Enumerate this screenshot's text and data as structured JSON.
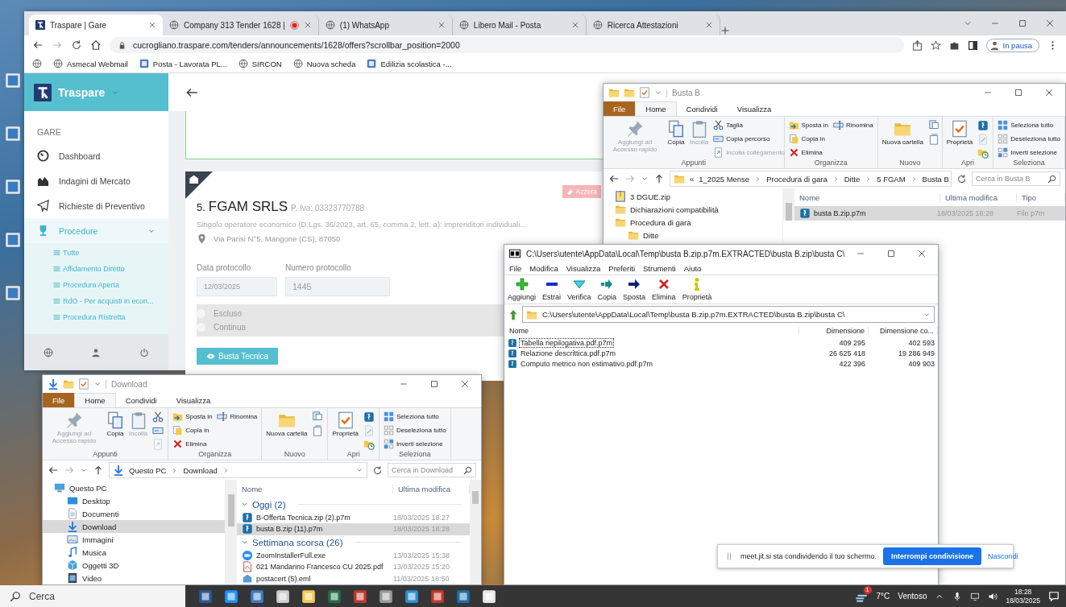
{
  "browser": {
    "tabs": [
      {
        "title": "Traspare | Gare",
        "selected": true,
        "recording": false
      },
      {
        "title": "Company 313 Tender 1628 |",
        "selected": false,
        "recording": true
      },
      {
        "title": "(1) WhatsApp",
        "selected": false,
        "recording": false
      },
      {
        "title": "Libero Mail - Posta",
        "selected": false,
        "recording": false
      },
      {
        "title": "Ricerca Attestazioni",
        "selected": false,
        "recording": false
      }
    ],
    "address": "cucrogliano.traspare.com/tenders/announcements/1628/offers?scrollbar_position=2000",
    "profile_status": "In pausa",
    "bookmarks": [
      "Asmecal Webmail",
      "Posta - Lavorata PL...",
      "SIRCON",
      "Nuova scheda",
      "Edilizia scolastica -..."
    ]
  },
  "app": {
    "brand": "Traspare",
    "section": "GARE",
    "nav": [
      {
        "label": "Dashboard",
        "selected": false,
        "expanded": false
      },
      {
        "label": "Indagini di Mercato",
        "selected": false,
        "expanded": false
      },
      {
        "label": "Richieste di Preventivo",
        "selected": false,
        "expanded": false
      },
      {
        "label": "Procedure",
        "selected": true,
        "expanded": true,
        "children": [
          "Tutte",
          "Affidamento Diretto",
          "Procedura Aperta",
          "RdO - Per acquisti in econ...",
          "Procedura Ristretta"
        ]
      }
    ]
  },
  "offer": {
    "number": "5.",
    "name": "FGAM SRLS",
    "vat": "P. Iva: 03323770788",
    "description": "Singolo operatore economico (D.Lgs. 36/2023, art. 65, comma 2, lett. a): imprenditori individuali...",
    "address": "Via Parisi N°5, Mangone (CS), 87050",
    "reset_button": "Azzera",
    "fields": [
      {
        "label": "Data protocollo",
        "value": "12/03/2025"
      },
      {
        "label": "Numero protocollo",
        "value": "1445"
      }
    ],
    "options": [
      {
        "label": "Escluso",
        "selected": false
      },
      {
        "label": "Continua",
        "selected": false
      }
    ],
    "action_button": "Busta Tecnica"
  },
  "explorer_busta_b": {
    "title": "Busta B",
    "ribbon_tabs": [
      {
        "label": "File",
        "kind": "file",
        "selected": false
      },
      {
        "label": "Home",
        "kind": "tab",
        "selected": true
      },
      {
        "label": "Condividi",
        "kind": "tab",
        "selected": false
      },
      {
        "label": "Visualizza",
        "kind": "tab",
        "selected": false
      }
    ],
    "groups": [
      {
        "label": "Appunti",
        "items": [
          {
            "label": "Aggiungi ad Accesso rapido",
            "kind": "large",
            "disabled": true
          },
          {
            "label": "Copia",
            "kind": "large",
            "disabled": false
          },
          {
            "label": "Incolla",
            "kind": "large",
            "disabled": true
          },
          {
            "label": "Taglia",
            "kind": "small",
            "disabled": false
          },
          {
            "label": "Copia percorso",
            "kind": "small",
            "disabled": false
          },
          {
            "label": "Incolla collegamento",
            "kind": "small",
            "disabled": true
          }
        ]
      },
      {
        "label": "Organizza",
        "items": [
          {
            "label": "Sposta in",
            "kind": "small",
            "disabled": false
          },
          {
            "label": "Copia in",
            "kind": "small",
            "disabled": false
          },
          {
            "label": "Elimina",
            "kind": "small",
            "disabled": false
          },
          {
            "label": "Rinomina",
            "kind": "small",
            "disabled": false
          }
        ]
      },
      {
        "label": "Nuovo",
        "items": [
          {
            "label": "Nuova cartella",
            "kind": "large",
            "disabled": false
          },
          {
            "kind": "icon",
            "disabled": false
          },
          {
            "kind": "icon",
            "disabled": false
          }
        ]
      },
      {
        "label": "Apri",
        "items": [
          {
            "label": "Proprietà",
            "kind": "large",
            "disabled": false
          },
          {
            "kind": "icon",
            "disabled": false
          },
          {
            "kind": "icon",
            "disabled": true
          },
          {
            "kind": "icon",
            "disabled": false
          }
        ]
      },
      {
        "label": "Seleziona",
        "items": [
          {
            "label": "Seleziona tutto",
            "kind": "small",
            "disabled": false
          },
          {
            "label": "Deseleziona tutto",
            "kind": "small",
            "disabled": false
          },
          {
            "label": "Inverti selezione",
            "kind": "small",
            "disabled": false
          }
        ]
      }
    ],
    "overflow": "«",
    "crumbs": [
      "1_2025 Mense",
      "Procedura di gara",
      "Ditte",
      "5 FGAM",
      "Busta B"
    ],
    "search_placeholder": "Cerca in Busta B",
    "tree": [
      {
        "label": "3 DGUE.zip",
        "selected": false
      },
      {
        "label": "Dichiarazioni compatibilità",
        "selected": false
      },
      {
        "label": "Procedura di gara",
        "selected": false,
        "children": [
          {
            "label": "Ditte",
            "selected": false
          }
        ]
      }
    ],
    "columns": [
      "Nome",
      "Ultima modifica",
      "Tipo"
    ],
    "files": [
      {
        "name": "busta B.zip.p7m",
        "modified": "18/03/2025 18:28",
        "type": "File p7m",
        "selected": true
      }
    ]
  },
  "archive": {
    "title": "C:\\Users\\utente\\AppData\\Local\\Temp\\busta B.zip.p7m.EXTRACTED\\busta B.zip\\busta C\\",
    "menu": [
      "File",
      "Modifica",
      "Visualizza",
      "Preferiti",
      "Strumenti",
      "Aiuto"
    ],
    "tools": [
      "Aggiungi",
      "Estrai",
      "Verifica",
      "Copia",
      "Sposta",
      "Elimina",
      "Proprietà"
    ],
    "path": "C:\\Users\\utente\\AppData\\Local\\Temp\\busta B.zip.p7m.EXTRACTED\\busta B.zip\\busta C\\",
    "columns": [
      "Nome",
      "Dimensione",
      "Dimensione co..."
    ],
    "rows": [
      {
        "name": "Tabella riepilogativa.pdf.p7m",
        "size": "409 295",
        "packed": "402 593",
        "focused": true
      },
      {
        "name": "Relazione descrittica.pdf.p7m",
        "size": "26 625 418",
        "packed": "19 286 949",
        "focused": false
      },
      {
        "name": "Computo metrico non estimativo.pdf.p7m",
        "size": "422 396",
        "packed": "409 903",
        "focused": false
      }
    ]
  },
  "explorer_download": {
    "title": "Download",
    "ribbon_tabs": [
      {
        "label": "File",
        "kind": "file",
        "selected": false
      },
      {
        "label": "Home",
        "kind": "tab",
        "selected": true
      },
      {
        "label": "Condividi",
        "kind": "tab",
        "selected": false
      },
      {
        "label": "Visualizza",
        "kind": "tab",
        "selected": false
      }
    ],
    "groups": [
      {
        "label": "Appunti",
        "items": [
          {
            "label": "Aggiungi ad Accesso rapido",
            "kind": "large",
            "disabled": true
          },
          {
            "label": "Copia",
            "kind": "large",
            "disabled": false
          },
          {
            "label": "Incolla",
            "kind": "large",
            "disabled": true
          },
          {
            "kind": "icon",
            "disabled": false
          },
          {
            "kind": "icon",
            "disabled": false
          },
          {
            "kind": "icon",
            "disabled": true
          }
        ]
      },
      {
        "label": "Organizza",
        "items": [
          {
            "label": "Sposta in",
            "kind": "small",
            "disabled": false
          },
          {
            "label": "Copia in",
            "kind": "small",
            "disabled": false
          },
          {
            "label": "Elimina",
            "kind": "small",
            "disabled": false
          },
          {
            "label": "Rinomina",
            "kind": "small",
            "disabled": false
          }
        ]
      },
      {
        "label": "Nuovo",
        "items": [
          {
            "label": "Nuova cartella",
            "kind": "large",
            "disabled": false
          },
          {
            "kind": "icon",
            "disabled": false
          },
          {
            "kind": "icon",
            "disabled": false
          }
        ]
      },
      {
        "label": "Apri",
        "items": [
          {
            "label": "Proprietà",
            "kind": "large",
            "disabled": false
          },
          {
            "kind": "icon",
            "disabled": false
          },
          {
            "kind": "icon",
            "disabled": true
          },
          {
            "kind": "icon",
            "disabled": false
          }
        ]
      },
      {
        "label": "Seleziona",
        "items": [
          {
            "label": "Seleziona tutto",
            "kind": "small",
            "disabled": false
          },
          {
            "label": "Deseleziona tutto",
            "kind": "small",
            "disabled": false
          },
          {
            "label": "Inverti selezione",
            "kind": "small",
            "disabled": false
          }
        ]
      }
    ],
    "crumbs": [
      "Questo PC",
      "Download"
    ],
    "search_placeholder": "Cerca in Download",
    "tree": [
      {
        "label": "Questo PC",
        "selected": false,
        "children": [
          {
            "label": "Desktop",
            "selected": false
          },
          {
            "label": "Documenti",
            "selected": false
          },
          {
            "label": "Download",
            "selected": true
          },
          {
            "label": "Immagini",
            "selected": false
          },
          {
            "label": "Musica",
            "selected": false
          },
          {
            "label": "Oggetti 3D",
            "selected": false
          },
          {
            "label": "Video",
            "selected": false
          }
        ]
      }
    ],
    "columns": [
      "Nome",
      "Ultima modifica"
    ],
    "file_groups": [
      {
        "label": "Oggi (2)",
        "expanded": true,
        "files": [
          {
            "name": "B-Offerta Tecnica.zip (2).p7m",
            "modified": "18/03/2025 18:27",
            "selected": false
          },
          {
            "name": "busta B.zip (11).p7m",
            "modified": "18/03/2025 18:28",
            "selected": true
          }
        ]
      },
      {
        "label": "Settimana scorsa (26)",
        "expanded": true,
        "files": [
          {
            "name": "ZoomInstallerFull.exe",
            "modified": "13/03/2025 15:38",
            "selected": false
          },
          {
            "name": "021 Mandarino Francesco CU 2025.pdf",
            "modified": "13/03/2025 15:20",
            "selected": false
          },
          {
            "name": "postacert (5).eml",
            "modified": "11/03/2025 18:50",
            "selected": false
          }
        ]
      }
    ]
  },
  "share_bar": {
    "message": "meet.jit.si sta condividendo il tuo schermo.",
    "stop_button": "Interrompi condivisione",
    "hide_link": "Nascondi"
  },
  "taskbar": {
    "search_placeholder": "Cerca",
    "weather_badge": "1",
    "temperature": "7°C",
    "weather": "Ventoso",
    "time": "18:28",
    "date": "18/03/2025"
  }
}
